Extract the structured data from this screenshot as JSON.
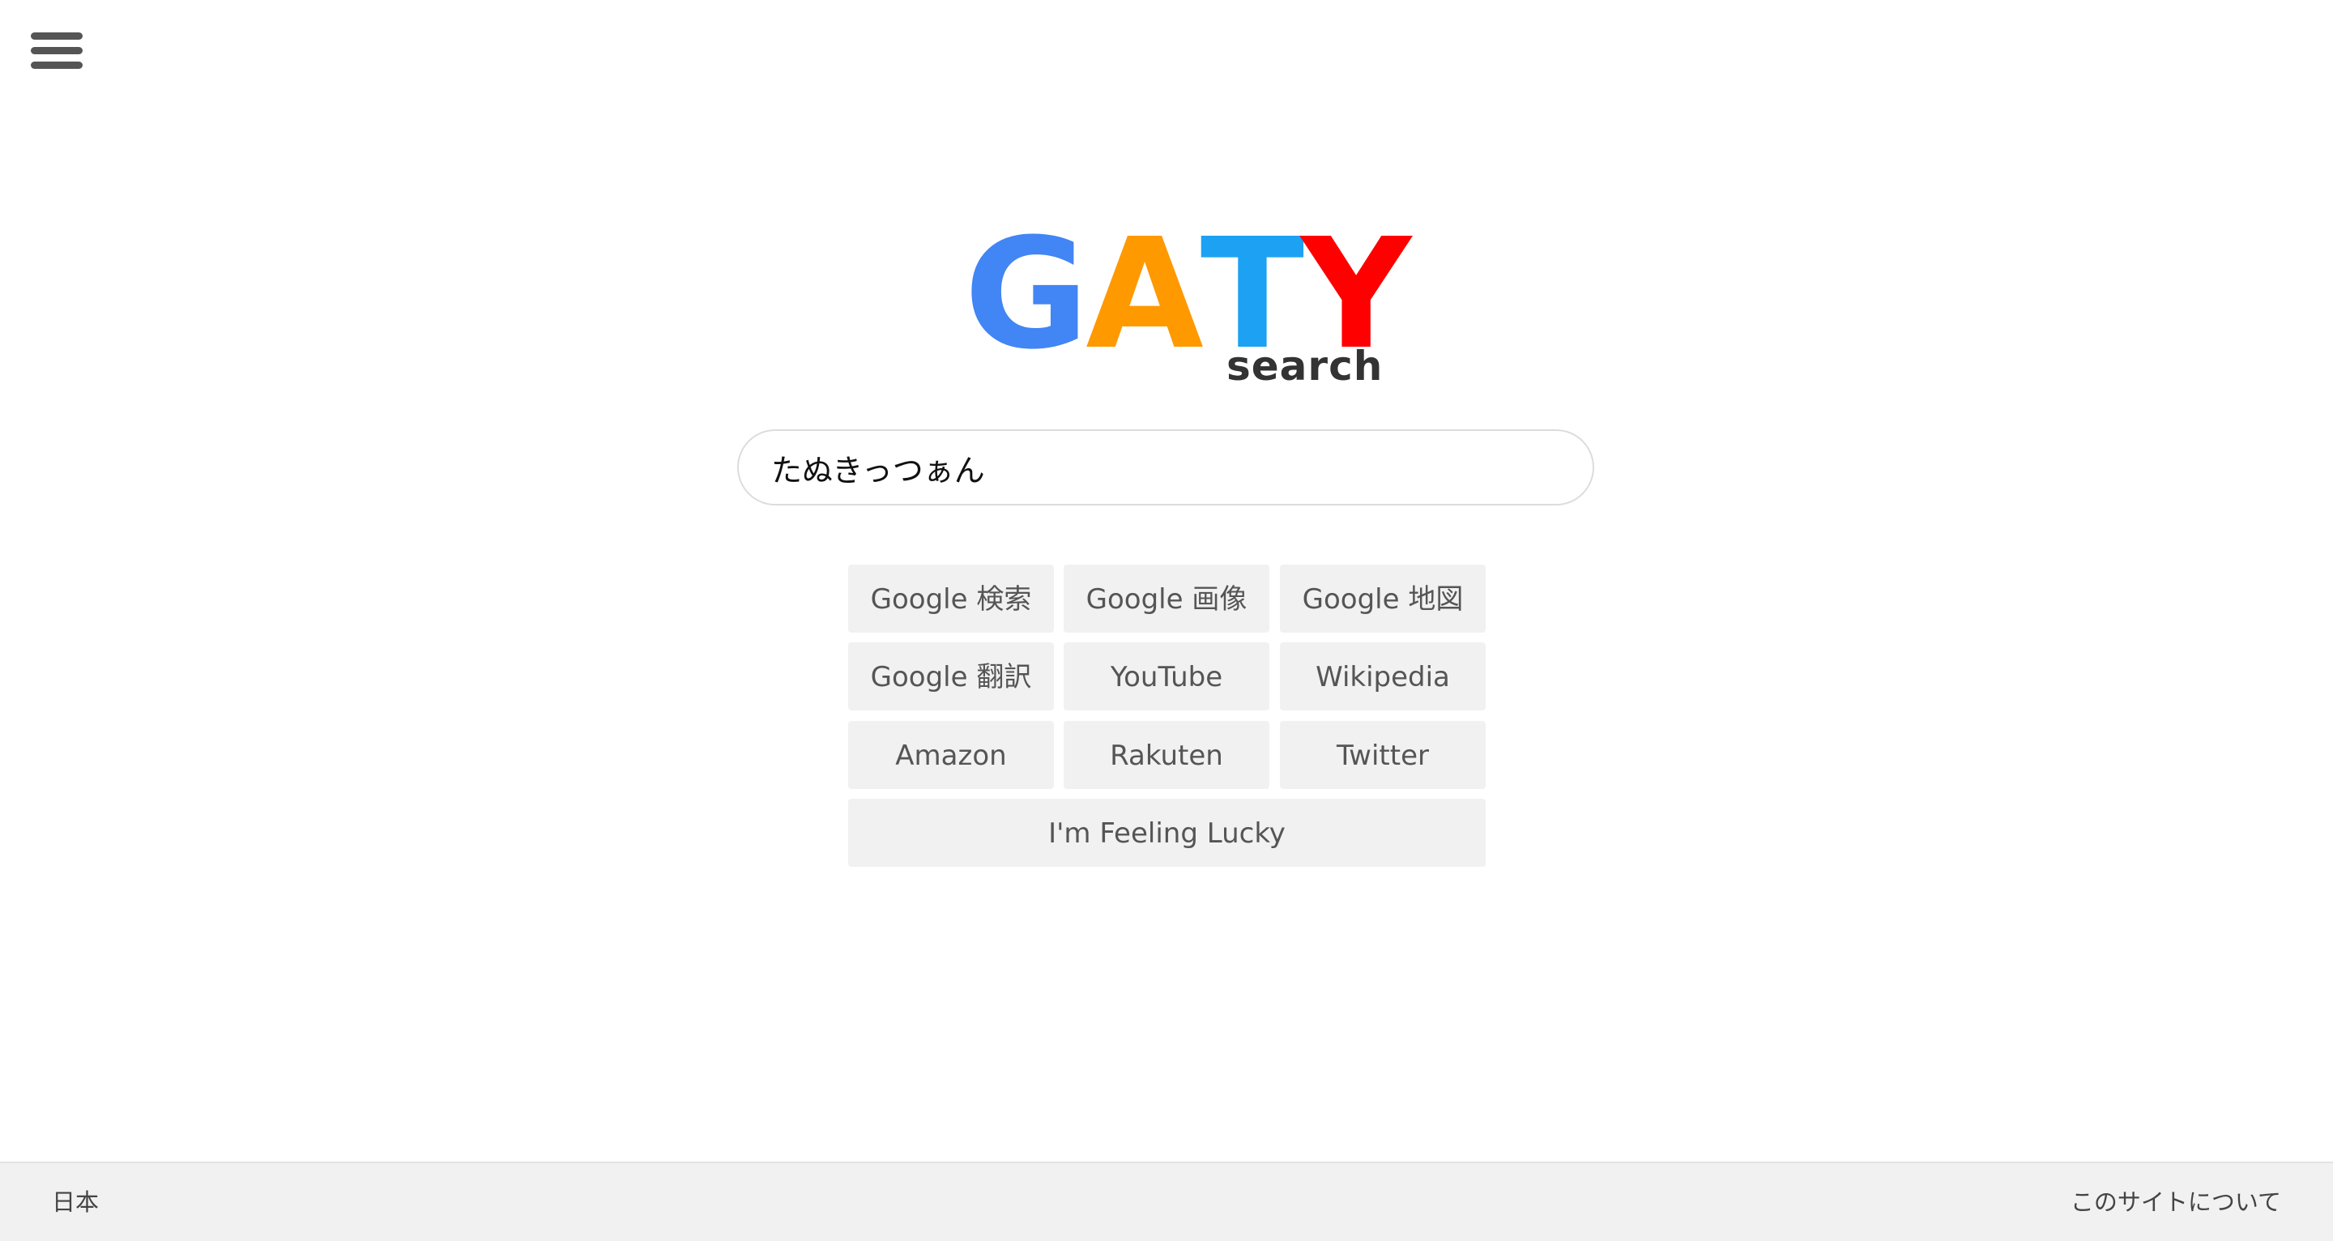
{
  "header": {
    "menu_icon": "hamburger-menu-icon"
  },
  "logo": {
    "letters": [
      {
        "char": "G",
        "color": "#4285F4"
      },
      {
        "char": "A",
        "color": "#FF9900"
      },
      {
        "char": "T",
        "color": "#1DA1F2"
      },
      {
        "char": "Y",
        "color": "#FF0000"
      }
    ],
    "subtitle": "search"
  },
  "search": {
    "value": "たぬきっつぁん",
    "placeholder": ""
  },
  "buttons": {
    "google_search": "Google 検索",
    "google_images": "Google 画像",
    "google_maps": "Google 地図",
    "google_translate": "Google 翻訳",
    "youtube": "YouTube",
    "wikipedia": "Wikipedia",
    "amazon": "Amazon",
    "rakuten": "Rakuten",
    "twitter": "Twitter",
    "lucky": "I'm Feeling Lucky"
  },
  "footer": {
    "country": "日本",
    "about": "このサイトについて"
  },
  "colors": {
    "button_bg": "#f1f1f1",
    "footer_bg": "#f1f1f1",
    "text_muted": "#555555"
  }
}
